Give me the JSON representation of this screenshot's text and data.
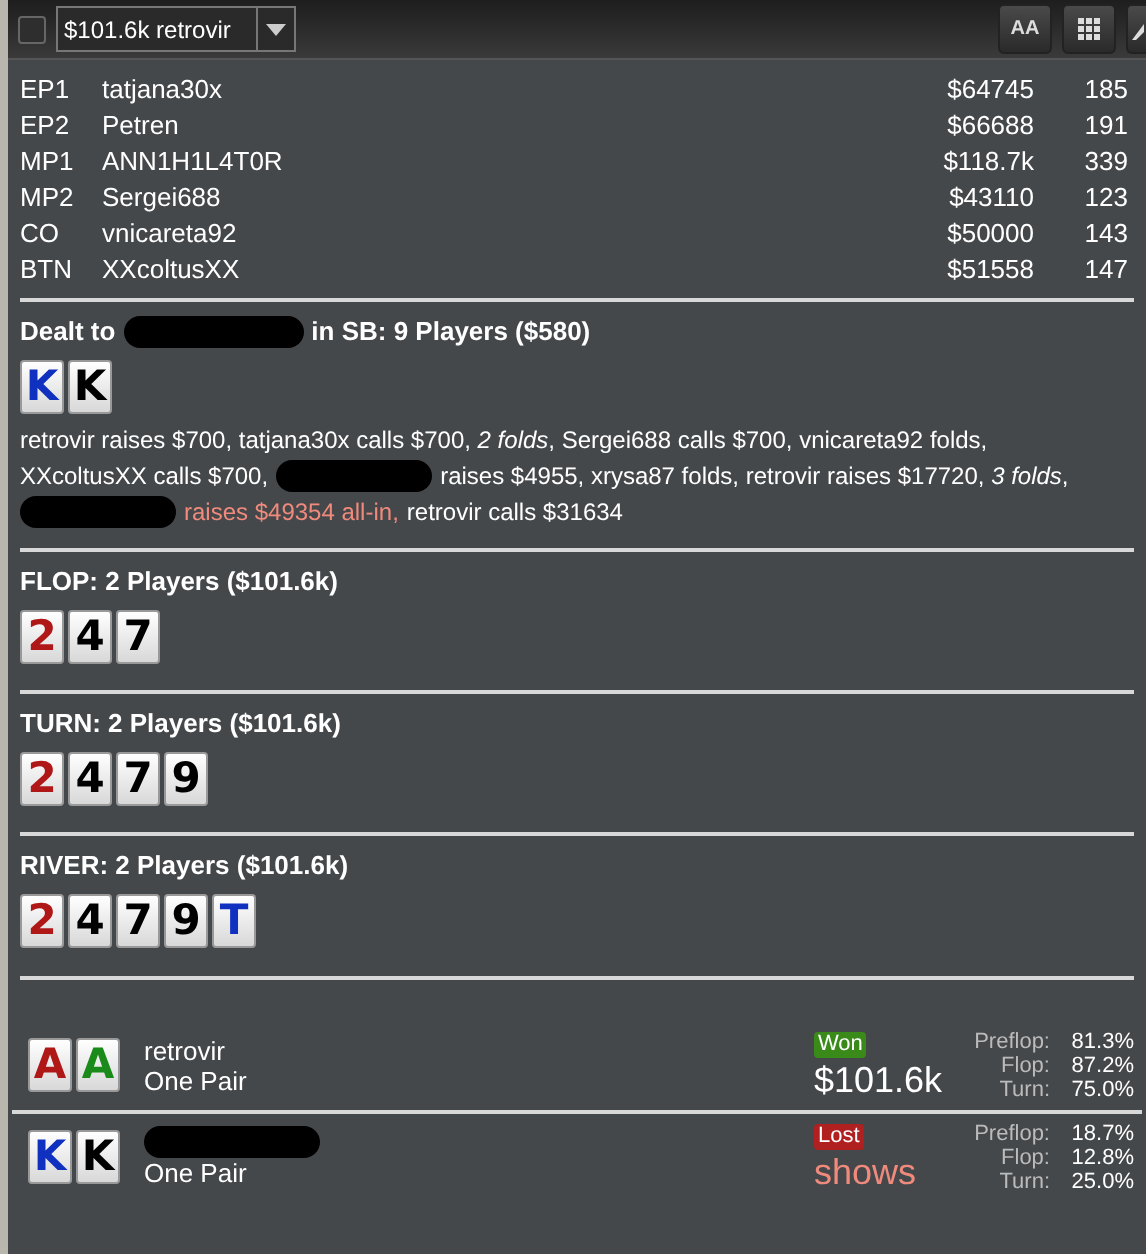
{
  "toolbar": {
    "checkbox": {
      "checked": false
    },
    "hand_select": {
      "value": "$101.6k retrovir"
    },
    "font_button": {
      "label": "AA"
    }
  },
  "players": [
    {
      "position": "EP1",
      "name": "tatjana30x",
      "stack": "$64745",
      "count": "185"
    },
    {
      "position": "EP2",
      "name": "Petren",
      "stack": "$66688",
      "count": "191"
    },
    {
      "position": "MP1",
      "name": "ANN1H1L4T0R",
      "stack": "$118.7k",
      "count": "339"
    },
    {
      "position": "MP2",
      "name": "Sergei688",
      "stack": "$43110",
      "count": "123"
    },
    {
      "position": "CO",
      "name": "vnicareta92",
      "stack": "$50000",
      "count": "143"
    },
    {
      "position": "BTN",
      "name": "XXcoltusXX",
      "stack": "$51558",
      "count": "147"
    }
  ],
  "streets": [
    {
      "title_parts": [
        {
          "kind": "text",
          "text": "Dealt to"
        },
        {
          "kind": "redacted"
        },
        {
          "kind": "text",
          "text": "in SB: 9 Players ($580)"
        }
      ],
      "cards": [
        {
          "rank": "K",
          "color": "#1030c0"
        },
        {
          "rank": "K",
          "color": "#000000"
        }
      ],
      "action_lines": [
        [
          {
            "kind": "plain",
            "text": "retrovir raises $700, tatjana30x calls $700, *2 folds*, Sergei688 calls $700, vnicareta92 folds,"
          }
        ],
        [
          {
            "kind": "plain",
            "text": "XXcoltusXX calls $700,"
          },
          {
            "kind": "redacted"
          },
          {
            "kind": "plain",
            "text": "raises $4955, xrysa87 folds, retrovir raises $17720, *3 folds*,"
          }
        ],
        [
          {
            "kind": "redacted"
          },
          {
            "kind": "allin",
            "text": "raises $49354 all-in,"
          },
          {
            "kind": "plain",
            "text": "retrovir calls $31634"
          }
        ]
      ]
    },
    {
      "title_parts": [
        {
          "kind": "text",
          "text": "FLOP: 2 Players ($101.6k)"
        }
      ],
      "cards": [
        {
          "rank": "2",
          "color": "#b01818"
        },
        {
          "rank": "4",
          "color": "#000000"
        },
        {
          "rank": "7",
          "color": "#000000"
        }
      ]
    },
    {
      "title_parts": [
        {
          "kind": "text",
          "text": "TURN: 2 Players ($101.6k)"
        }
      ],
      "cards": [
        {
          "rank": "2",
          "color": "#b01818"
        },
        {
          "rank": "4",
          "color": "#000000"
        },
        {
          "rank": "7",
          "color": "#000000"
        },
        {
          "rank": "9",
          "color": "#000000"
        }
      ]
    },
    {
      "title_parts": [
        {
          "kind": "text",
          "text": "RIVER: 2 Players ($101.6k)"
        }
      ],
      "cards": [
        {
          "rank": "2",
          "color": "#b01818"
        },
        {
          "rank": "4",
          "color": "#000000"
        },
        {
          "rank": "7",
          "color": "#000000"
        },
        {
          "rank": "9",
          "color": "#000000"
        },
        {
          "rank": "T",
          "color": "#1030c0"
        }
      ]
    }
  ],
  "showdown": [
    {
      "cards": [
        {
          "rank": "A",
          "color": "#b01818"
        },
        {
          "rank": "A",
          "color": "#1a8a1a"
        }
      ],
      "name": "retrovir",
      "name_redacted": false,
      "hand": "One Pair",
      "result": {
        "kind": "won",
        "badge": "Won",
        "amount": "$101.6k"
      },
      "equity": [
        {
          "label": "Preflop:",
          "value": "81.3%"
        },
        {
          "label": "Flop:",
          "value": "87.2%"
        },
        {
          "label": "Turn:",
          "value": "75.0%"
        }
      ]
    },
    {
      "cards": [
        {
          "rank": "K",
          "color": "#1030c0"
        },
        {
          "rank": "K",
          "color": "#000000"
        }
      ],
      "name_redacted": true,
      "hand": "One Pair",
      "result": {
        "kind": "lost",
        "badge": "Lost",
        "amount": "shows"
      },
      "equity": [
        {
          "label": "Preflop:",
          "value": "18.7%"
        },
        {
          "label": "Flop:",
          "value": "12.8%"
        },
        {
          "label": "Turn:",
          "value": "25.0%"
        }
      ]
    }
  ]
}
